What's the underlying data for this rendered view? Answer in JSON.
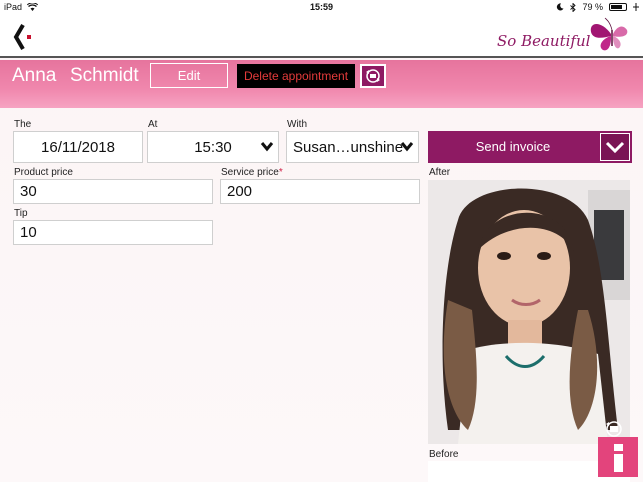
{
  "status_bar": {
    "device": "iPad",
    "time": "15:59",
    "battery": "79 %",
    "battery_level": 0.79
  },
  "logo": {
    "text": "So Beautiful"
  },
  "client": {
    "first_name": "Anna",
    "last_name": "Schmidt"
  },
  "actions": {
    "edit_label": "Edit",
    "delete_label": "Delete appointment"
  },
  "form": {
    "date_label": "The",
    "date_value": "16/11/2018",
    "time_label": "At",
    "time_value": "15:30",
    "with_label": "With",
    "with_value": "Susan…unshine",
    "product_price_label": "Product price",
    "product_price_value": "30",
    "service_price_label": "Service price",
    "service_price_required": "*",
    "service_price_value": "200",
    "tip_label": "Tip",
    "tip_value": "10"
  },
  "invoice": {
    "send_label": "Send invoice"
  },
  "photos": {
    "after_label": "After",
    "before_label": "Before"
  },
  "colors": {
    "accent": "#8e1a63",
    "header_pink": "#f087ad",
    "delete_text": "#e43b3b"
  },
  "icons": [
    "back-chevron-icon",
    "butterfly-logo-icon",
    "sync-icon",
    "chevron-down-icon",
    "camera-icon",
    "info-icon",
    "wifi-icon",
    "bluetooth-icon",
    "battery-icon"
  ]
}
